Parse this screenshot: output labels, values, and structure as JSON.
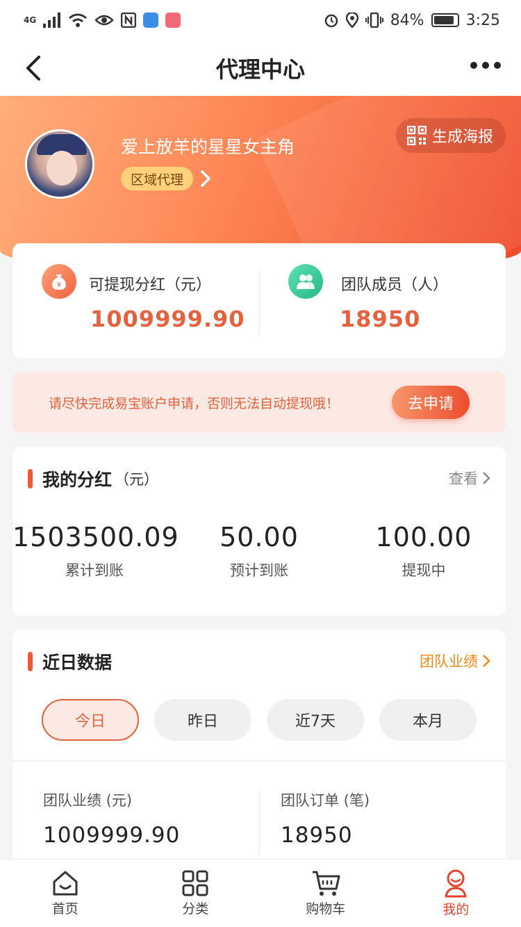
{
  "status_bar": {
    "network": "4G",
    "battery": "84%",
    "time": "3:25"
  },
  "nav": {
    "title": "代理中心"
  },
  "profile": {
    "username": "爱上放羊的星星女主角",
    "role": "区域代理",
    "poster_button": "生成海报"
  },
  "summary": {
    "withdrawable_label": "可提现分红（元）",
    "withdrawable_value": "1009999.90",
    "team_label": "团队成员（人）",
    "team_value": "18950"
  },
  "notice": {
    "text": "请尽快完成易宝账户申请，否则无法自动提现哦！",
    "button": "去申请"
  },
  "dividends": {
    "title": "我的分红",
    "unit": "（元）",
    "link": "查看",
    "stats": [
      {
        "value": "1503500.09",
        "label": "累计到账"
      },
      {
        "value": "50.00",
        "label": "预计到账"
      },
      {
        "value": "100.00",
        "label": "提现中"
      }
    ]
  },
  "recent": {
    "title": "近日数据",
    "link": "团队业绩",
    "tabs": [
      "今日",
      "昨日",
      "近7天",
      "本月"
    ],
    "active_tab": "今日",
    "performance_label": "团队业绩 (元)",
    "performance_value": "1009999.90",
    "orders_label": "团队订单 (笔)",
    "orders_value": "18950"
  },
  "tabbar": {
    "items": [
      {
        "label": "首页",
        "icon": "home-icon"
      },
      {
        "label": "分类",
        "icon": "grid-icon"
      },
      {
        "label": "购物车",
        "icon": "cart-icon"
      },
      {
        "label": "我的",
        "icon": "profile-icon"
      }
    ],
    "active": "我的"
  },
  "colors": {
    "accent": "#e4623d",
    "active_tab": "#e8432f",
    "link_orange": "#f08a17",
    "badge": "#ffd17a"
  }
}
